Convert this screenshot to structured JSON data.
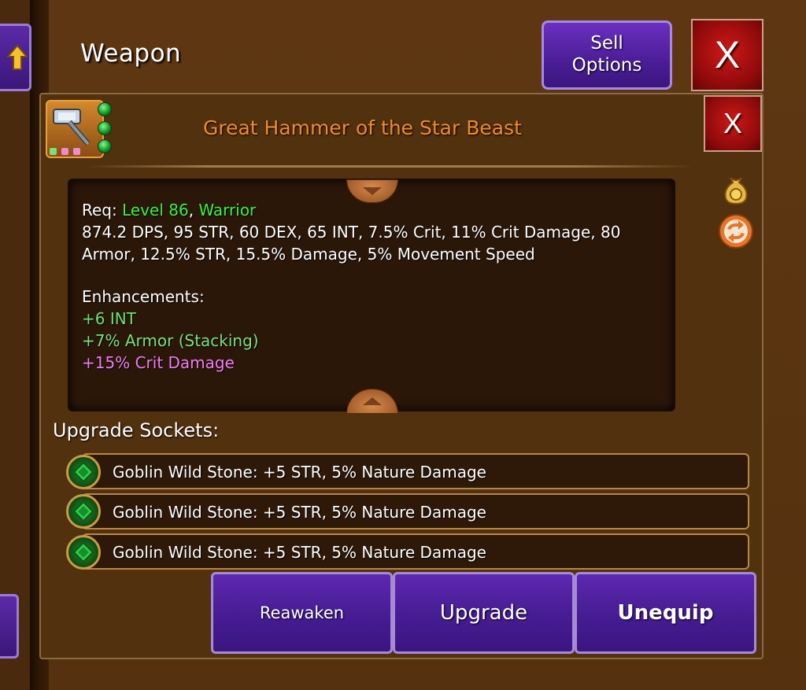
{
  "header": {
    "title": "Weapon",
    "sell_options_label": "Sell\nOptions",
    "close_label": "X"
  },
  "item": {
    "name": "Great Hammer of the Star Beast",
    "close_label": "X",
    "icon": "hammer-icon",
    "name_color": "#f08a2a"
  },
  "description": {
    "req_prefix": "Req: ",
    "req_level": "Level 86",
    "req_sep": ", ",
    "req_class": "Warrior",
    "stats": "874.2 DPS, 95 STR, 60 DEX, 65 INT, 7.5% Crit, 11% Crit Damage, 80 Armor, 12.5% STR, 15.5% Damage, 5% Movement Speed",
    "enhancements_label": "Enhancements:",
    "enhancements": [
      {
        "text": "+6 INT",
        "color": "#6ce06c"
      },
      {
        "text": "+7% Armor (Stacking)",
        "color": "#7be07b"
      },
      {
        "text": "+15% Crit Damage",
        "color": "#f07cf0"
      }
    ]
  },
  "side_icons": [
    "coin-bag-icon",
    "swap-icon"
  ],
  "sockets": {
    "label": "Upgrade Sockets:",
    "items": [
      {
        "text": "Goblin Wild Stone: +5 STR, 5% Nature Damage",
        "icon": "green-gem-icon"
      },
      {
        "text": "Goblin Wild Stone: +5 STR, 5% Nature Damage",
        "icon": "green-gem-icon"
      },
      {
        "text": "Goblin Wild Stone: +5 STR, 5% Nature Damage",
        "icon": "green-gem-icon"
      }
    ]
  },
  "actions": {
    "reawaken": "Reawaken",
    "upgrade": "Upgrade",
    "unequip": "Unequip"
  },
  "colors": {
    "button_purple": "#4b1d96",
    "close_red": "#c01414",
    "panel_brown": "#52310f",
    "req_green": "#3cf03c"
  }
}
